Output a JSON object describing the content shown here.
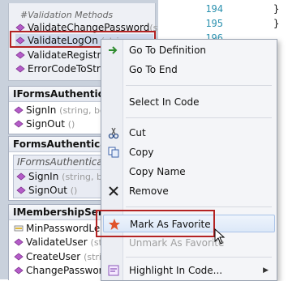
{
  "diagram": {
    "validation_section_label": "#Validation Methods",
    "validation_members": [
      {
        "name": "ValidateChangePassword",
        "sig": "(stri"
      },
      {
        "name": "ValidateLogOn",
        "sig": "(string,"
      },
      {
        "name": "ValidateRegistrati",
        "sig": ""
      },
      {
        "name": "ErrorCodeToStrin",
        "sig": ""
      }
    ],
    "iforms_auth": {
      "title": "IFormsAuthentication",
      "members": [
        {
          "name": "SignIn",
          "sig": "(string, bool)"
        },
        {
          "name": "SignOut",
          "sig": "()"
        }
      ]
    },
    "forms_auth": {
      "title": "FormsAuthentication",
      "inner_title": "IFormsAuthentication",
      "members": [
        {
          "name": "SignIn",
          "sig": "(string, boo"
        },
        {
          "name": "SignOut",
          "sig": "()"
        }
      ]
    },
    "imembership": {
      "title": "IMembershipServic",
      "members": [
        {
          "name": "MinPasswordLeng",
          "sig": ""
        },
        {
          "name": "ValidateUser",
          "sig": "(string"
        },
        {
          "name": "CreateUser",
          "sig": "(string"
        },
        {
          "name": "ChangePassword",
          "sig": ""
        }
      ]
    }
  },
  "editor": {
    "lines": [
      {
        "no": "194",
        "text": "}"
      },
      {
        "no": "195",
        "text": "}"
      },
      {
        "no": "196",
        "text": ""
      }
    ]
  },
  "context_menu": {
    "items": [
      {
        "label": "Go To Definition",
        "icon": "arrow-right-icon",
        "enabled": true
      },
      {
        "label": "Go To End",
        "icon": "",
        "enabled": true
      },
      {
        "label": "Select In Code",
        "icon": "",
        "enabled": true
      },
      {
        "label": "Cut",
        "icon": "scissors-icon",
        "enabled": true
      },
      {
        "label": "Copy",
        "icon": "copy-icon",
        "enabled": true
      },
      {
        "label": "Copy Name",
        "icon": "",
        "enabled": true
      },
      {
        "label": "Remove",
        "icon": "x-icon",
        "enabled": true
      },
      {
        "label": "Mark As Favorite",
        "icon": "star-icon",
        "enabled": true,
        "hover": true
      },
      {
        "label": "Unmark As Favorite",
        "icon": "",
        "enabled": false
      },
      {
        "label": "Highlight In Code...",
        "icon": "highlight-icon",
        "enabled": true,
        "submenu": true
      }
    ]
  },
  "colors": {
    "highlight_frame": "#b42323",
    "line_numbers": "#2b91af",
    "star": "#e0532a"
  }
}
